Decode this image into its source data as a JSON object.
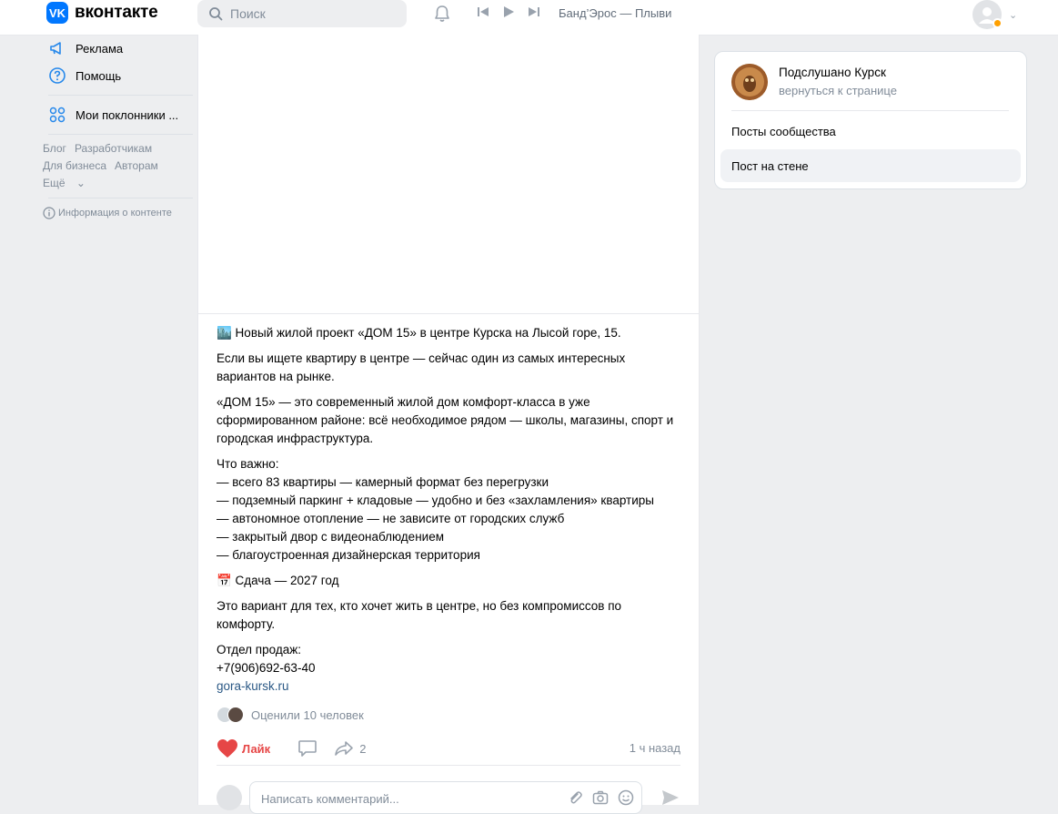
{
  "header": {
    "logo_text": "вконтакте",
    "logo_badge": "VK",
    "search_placeholder": "Поиск",
    "track": "Банд’Эрос — Плыви"
  },
  "left_nav": {
    "items": [
      {
        "label": "Реклама",
        "icon": "megaphone-icon"
      },
      {
        "label": "Помощь",
        "icon": "help-icon"
      },
      {
        "label": "Мои поклонники ...",
        "icon": "apps-icon"
      }
    ],
    "footer_links": [
      "Блог",
      "Разработчикам",
      "Для бизнеса",
      "Авторам",
      "Ещё"
    ],
    "info": "Информация о контенте"
  },
  "post": {
    "line1": "🏙️ Новый жилой проект «ДОМ 15» в центре Курска на Лысой горе, 15.",
    "para1": "Если вы ищете квартиру в центре — сейчас один из самых интересных вариантов на рынке.",
    "para2": "«ДОМ 15» — это современный жилой дом комфорт-класса в уже сформированном районе: всё необходимое рядом — школы, магазины, спорт и городская инфраструктура.",
    "important_title": "Что важно:",
    "bullets": [
      "— всего 83 квартиры — камерный формат без перегрузки",
      "— подземный паркинг + кладовые — удобно и без «захламления» квартиры",
      "— автономное отопление — не зависите от городских служб",
      "— закрытый двор с видеонаблюдением",
      "— благоустроенная дизайнерская территория"
    ],
    "delivery": "📅 Сдача — 2027 год",
    "para3": "Это вариант для тех, кто хочет жить в центре, но без компромиссов по комфорту.",
    "sales_title": "Отдел продаж:",
    "phone": "+7(906)692-63-40",
    "site": "gora-kursk.ru",
    "rated": "Оценили 10 человек",
    "like_label": "Лайк",
    "shares": "2",
    "time": "1 ч назад",
    "comment_placeholder": "Написать комментарий..."
  },
  "group_card": {
    "name": "Подслушано Курск",
    "back": "вернуться к странице",
    "item1": "Посты сообщества",
    "item2": "Пост на стене"
  },
  "colors": {
    "accent": "#0077ff",
    "like": "#e64646",
    "link": "#2a5885",
    "muted": "#818c99"
  }
}
